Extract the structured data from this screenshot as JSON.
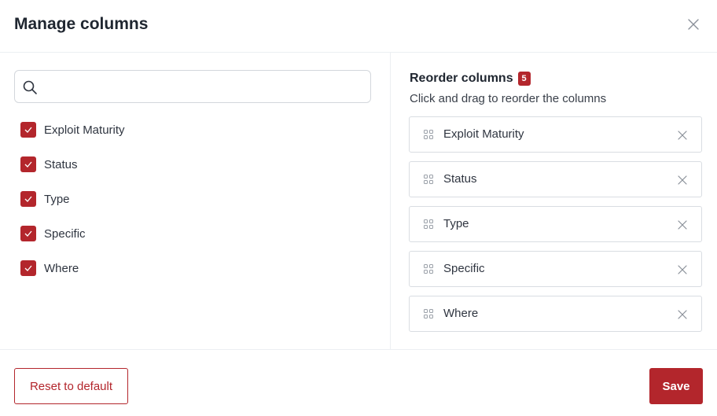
{
  "header": {
    "title": "Manage columns",
    "close_icon": "close-icon"
  },
  "search": {
    "value": "",
    "placeholder": "",
    "icon": "search-icon"
  },
  "columns": [
    {
      "label": "Exploit Maturity",
      "checked": true
    },
    {
      "label": "Status",
      "checked": true
    },
    {
      "label": "Type",
      "checked": true
    },
    {
      "label": "Specific",
      "checked": true
    },
    {
      "label": "Where",
      "checked": true
    }
  ],
  "reorder": {
    "title": "Reorder columns",
    "count": "5",
    "subtitle": "Click and drag to reorder the columns",
    "items": [
      "Exploit Maturity",
      "Status",
      "Type",
      "Specific",
      "Where"
    ]
  },
  "footer": {
    "reset_label": "Reset to default",
    "save_label": "Save"
  },
  "colors": {
    "accent": "#b3262c",
    "border": "#d9dde2",
    "divider": "#eceff2"
  }
}
